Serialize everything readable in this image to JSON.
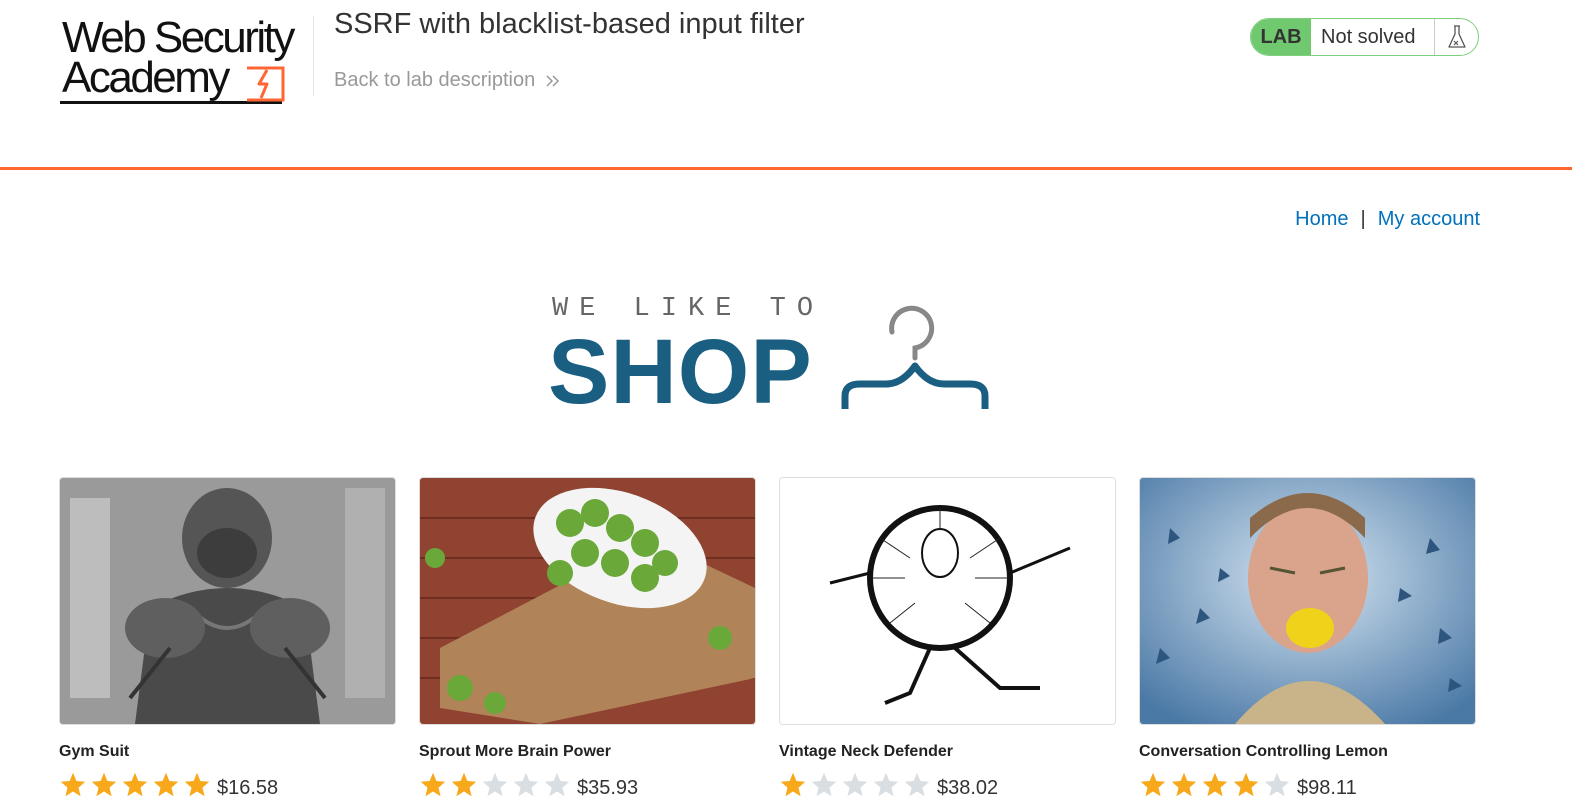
{
  "header": {
    "logo_line1": "Web Security",
    "logo_line2": "Academy",
    "lab_title": "SSRF with blacklist-based input filter",
    "back_link": "Back to lab description",
    "lab_badge": "LAB",
    "lab_status": "Not solved",
    "status_icon": "flask-icon"
  },
  "nav": {
    "home": "Home",
    "separator": "|",
    "my_account": "My account"
  },
  "banner": {
    "tagline_small": "WE LIKE TO",
    "tagline_big": "SHOP",
    "icon": "hanger-icon"
  },
  "colors": {
    "accent_orange": "#ff6633",
    "lab_green": "#70c96e",
    "link_blue": "#0071bc",
    "shop_blue": "#1a5e82",
    "star_gold": "#f7a81b",
    "star_gray": "#d9dee3"
  },
  "products": [
    {
      "name": "Gym Suit",
      "rating": 5,
      "max_rating": 5,
      "price": "$16.58"
    },
    {
      "name": "Sprout More Brain Power",
      "rating": 2,
      "max_rating": 5,
      "price": "$35.93"
    },
    {
      "name": "Vintage Neck Defender",
      "rating": 1,
      "max_rating": 5,
      "price": "$38.02"
    },
    {
      "name": "Conversation Controlling Lemon",
      "rating": 4,
      "max_rating": 5,
      "price": "$98.11"
    }
  ]
}
